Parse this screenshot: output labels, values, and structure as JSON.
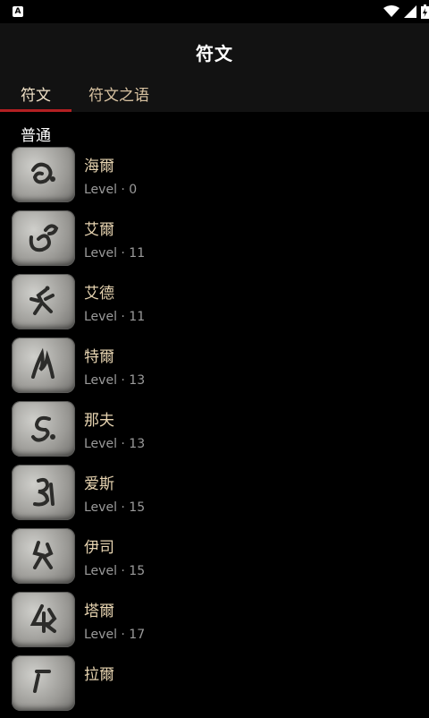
{
  "status_bar": {
    "app_icon_letter": "A"
  },
  "header": {
    "title": "符文"
  },
  "tabs": [
    {
      "label": "符文",
      "active": true
    },
    {
      "label": "符文之语",
      "active": false
    }
  ],
  "colors": {
    "accent": "#b31f22",
    "tab_text": "#d8c2a1",
    "rune_name": "#e6d3b0"
  },
  "section": {
    "title": "普通"
  },
  "runes": [
    {
      "name": "海爾",
      "level": "Level · 0",
      "icon": "rune-el-icon"
    },
    {
      "name": "艾爾",
      "level": "Level · 11",
      "icon": "rune-eld-icon"
    },
    {
      "name": "艾德",
      "level": "Level · 11",
      "icon": "rune-tir-icon"
    },
    {
      "name": "特爾",
      "level": "Level · 13",
      "icon": "rune-nef-icon"
    },
    {
      "name": "那夫",
      "level": "Level · 13",
      "icon": "rune-eth-icon"
    },
    {
      "name": "爱斯",
      "level": "Level · 15",
      "icon": "rune-ith-icon"
    },
    {
      "name": "伊司",
      "level": "Level · 15",
      "icon": "rune-tal-icon"
    },
    {
      "name": "塔爾",
      "level": "Level · 17",
      "icon": "rune-ral-icon"
    },
    {
      "name": "拉爾",
      "level": "",
      "icon": "rune-ort-icon"
    }
  ]
}
